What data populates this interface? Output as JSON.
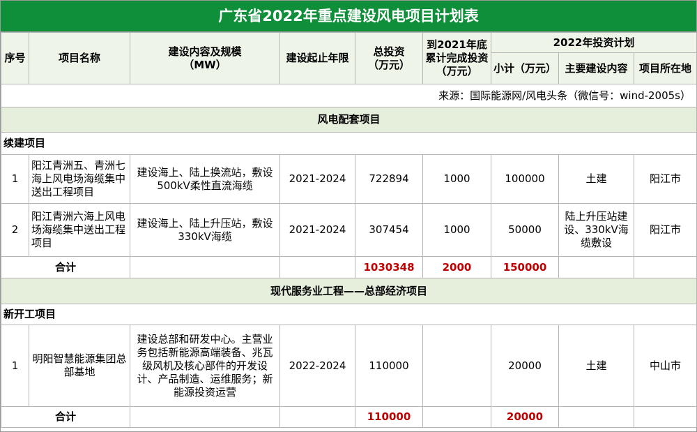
{
  "title": "广东省2022年重点建设风电项目计划表",
  "headers": {
    "seq": "序号",
    "name": "项目名称",
    "content_line1": "建设内容及规模",
    "content_line2": "（MW）",
    "period": "建设起止年限",
    "total_line1": "总投资",
    "total_line2": "（万元）",
    "done_line1": "到2021年底",
    "done_line2": "累计完成投资",
    "done_line3": "（万元）",
    "plan2022": "2022年投资计划",
    "subtotal": "小计（万元）",
    "main_content": "主要建设内容",
    "location": "项目所在地"
  },
  "source": "来源：国际能源网/风电头条（微信号：wind-2005s）",
  "section1": {
    "title": "风电配套项目",
    "subheading": "续建项目",
    "rows": [
      {
        "seq": "1",
        "name": "阳江青洲五、青洲七海上风电场海缆集中送出工程项目",
        "content": "建设海上、陆上换流站，敷设500kV柔性直流海缆",
        "period": "2021-2024",
        "total": "722894",
        "done": "1000",
        "subtotal": "100000",
        "main": "土建",
        "location": "阳江市"
      },
      {
        "seq": "2",
        "name": "阳江青洲六海上风电场海缆集中送出工程项目",
        "content": "建设海上、陆上升压站，敷设330kV海缆",
        "period": "2021-2024",
        "total": "307454",
        "done": "1000",
        "subtotal": "50000",
        "main": "陆上升压站建设、330kV海缆敷设",
        "location": "阳江市"
      }
    ],
    "sum": {
      "label": "合计",
      "total": "1030348",
      "done": "2000",
      "subtotal": "150000"
    }
  },
  "section2": {
    "title": "现代服务业工程——总部经济项目",
    "subheading": "新开工项目",
    "rows": [
      {
        "seq": "1",
        "name": "明阳智慧能源集团总部基地",
        "content": "建设总部和研发中心。主营业务包括新能源高端装备、兆瓦级风机及核心部件的开发设计、产品制造、运维服务；新能源投资运营",
        "period": "2022-2024",
        "total": "110000",
        "done": "",
        "subtotal": "20000",
        "main": "土建",
        "location": "中山市"
      }
    ],
    "sum": {
      "label": "合计",
      "total": "110000",
      "done": "",
      "subtotal": "20000"
    }
  },
  "colors": {
    "title_bg": "#0f8f3a",
    "section_bg": "#e5efdc",
    "sum_red": "#c00000"
  }
}
